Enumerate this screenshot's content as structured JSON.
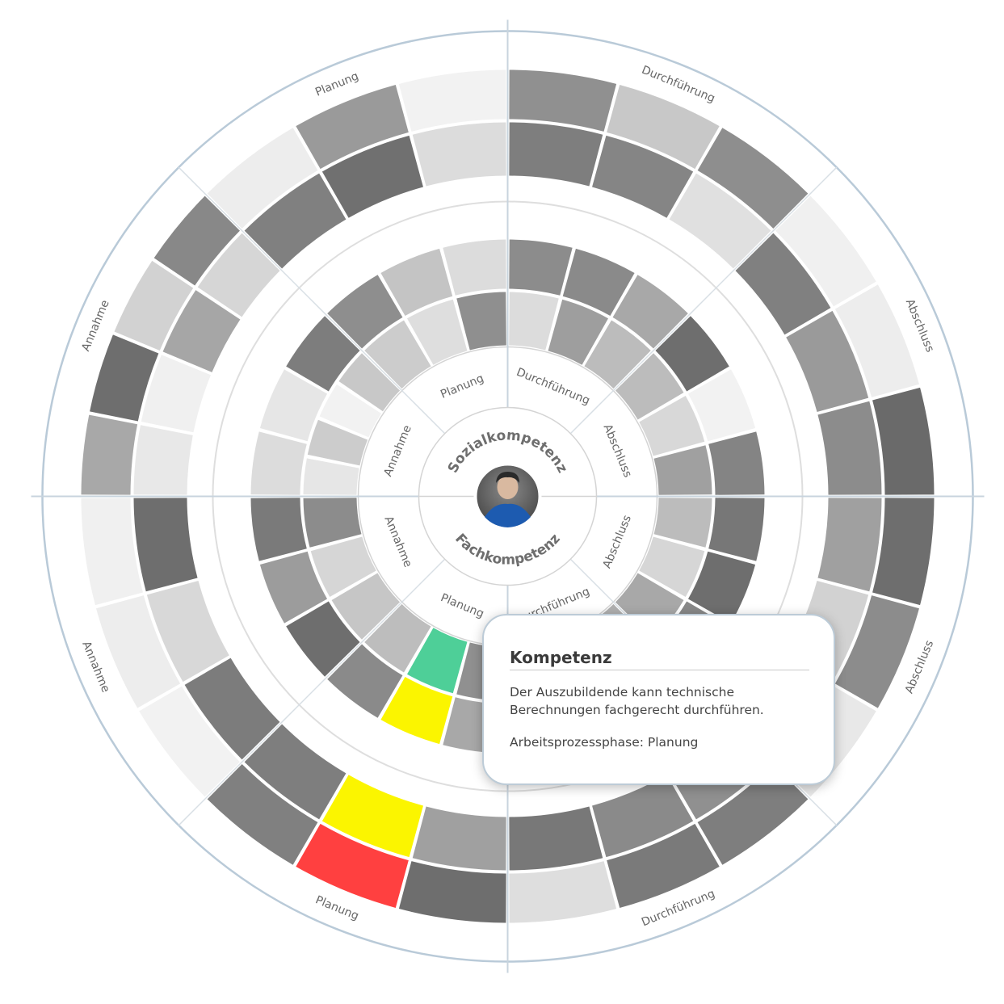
{
  "diagram": {
    "halves": [
      {
        "name": "Sozialkompetenz",
        "phases": [
          {
            "label": "Annahme",
            "rings": [
              [
                "#e6e6e6",
                "#cccccc",
                "#f2f2f2",
                "#c8c8c8"
              ],
              [
                "#dcdcdc",
                "#e6e6e6",
                "#7d7d7d"
              ],
              [
                "#e8e8e8",
                "#f0f0f0",
                "#a6a6a6",
                "#d6d6d6"
              ],
              [
                "#a8a8a8",
                "#6e6e6e",
                "#d2d2d2",
                "#888888"
              ]
            ]
          },
          {
            "label": "Planung",
            "rings": [
              [
                "#cccccc",
                "#dedede",
                "#8f8f8f"
              ],
              [
                "#8e8e8e",
                "#c4c4c4",
                "#dcdcdc"
              ],
              [
                "#808080",
                "#707070",
                "#dcdcdc"
              ],
              [
                "#ededed",
                "#9a9a9a",
                "#f2f2f2"
              ]
            ]
          },
          {
            "label": "Durchführung",
            "rings": [
              [
                "#dcdcdc",
                "#9e9e9e",
                "#bcbcbc"
              ],
              [
                "#8c8c8c",
                "#8a8a8a",
                "#a8a8a8"
              ],
              [
                "#7e7e7e",
                "#858585",
                "#e0e0e0"
              ],
              [
                "#909090",
                "#c8c8c8",
                "#8e8e8e"
              ]
            ]
          },
          {
            "label": "Abschluss",
            "rings": [
              [
                "#bcbcbc",
                "#d8d8d8",
                "#a0a0a0"
              ],
              [
                "#6e6e6e",
                "#f2f2f2",
                "#848484"
              ],
              [
                "#808080",
                "#9a9a9a",
                "#8c8c8c"
              ],
              [
                "#f0f0f0",
                "#ededed",
                "#6a6a6a"
              ]
            ]
          }
        ]
      },
      {
        "name": "Fachkompetenz",
        "phases": [
          {
            "label": "Abschluss",
            "rings": [
              [
                "#bcbcbc",
                "#d6d6d6",
                "#a8a8a8"
              ],
              [
                "#777777",
                "#6e6e6e",
                "#888888"
              ],
              [
                "#a0a0a0",
                "#d2d2d2",
                "#8a8a8a"
              ],
              [
                "#6e6e6e",
                "#8c8c8c",
                "#e8e8e8"
              ]
            ]
          },
          {
            "label": "Durchführung",
            "rings": [
              [
                "#b0b0b0",
                "#a8a8a8",
                "#9c9c9c"
              ],
              [
                "#909090",
                "#8a8a8a",
                "#e0e0e0"
              ],
              [
                "#909090",
                "#8a8a8a",
                "#787878"
              ],
              [
                "#7e7e7e",
                "#7a7a7a",
                "#dedede"
              ]
            ]
          },
          {
            "label": "Planung",
            "rings": [
              [
                "#909090",
                "#4ecf98",
                "#bdbdbd"
              ],
              [
                "#a8a8a8",
                "#fbf500",
                "#8a8a8a"
              ],
              [
                "#a0a0a0",
                "#fbf500",
                "#7e7e7e"
              ],
              [
                "#6e6e6e",
                "#ff4040",
                "#808080"
              ]
            ]
          },
          {
            "label": "Annahme",
            "rings": [
              [
                "#c6c6c6",
                "#d6d6d6",
                "#8c8c8c"
              ],
              [
                "#6e6e6e",
                "#9c9c9c",
                "#7a7a7a"
              ],
              [
                "#7c7c7c",
                "#d8d8d8",
                "#6e6e6e"
              ],
              [
                "#f2f2f2",
                "#ededed",
                "#f0f0f0"
              ]
            ]
          }
        ]
      }
    ]
  },
  "tooltip": {
    "title": "Kompetenz",
    "text": "Der Auszubildende kann technische Berechnungen fachgerecht durchführen.",
    "phase": "Arbeitsprozessphase: Planung"
  }
}
